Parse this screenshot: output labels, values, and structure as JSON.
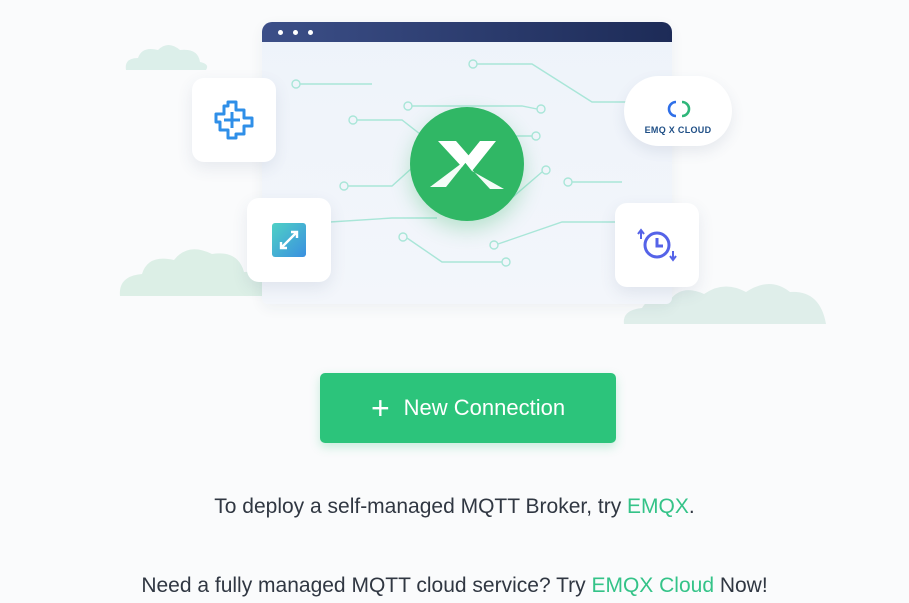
{
  "illustration": {
    "cloud_badge_label": "EMQ X CLOUD",
    "icons": [
      "browser-window-icon",
      "mqttx-logo-icon",
      "plugin-icon",
      "resize-icon",
      "history-icon",
      "emqx-cloud-icon"
    ]
  },
  "actions": {
    "new_connection_label": "New Connection",
    "new_connection_icon": "plus"
  },
  "footer": {
    "line1_prefix": "To deploy a self-managed MQTT Broker, try ",
    "line1_link": "EMQX",
    "line1_suffix": ".",
    "line2_prefix": "Need a fully managed MQTT cloud service? Try ",
    "line2_link": "EMQX Cloud",
    "line2_suffix": " Now!"
  },
  "colors": {
    "primary": "#2cc47b",
    "logo": "#30b765",
    "link": "#34c388",
    "text": "#303742",
    "browser_bar": "#1d2b57"
  }
}
